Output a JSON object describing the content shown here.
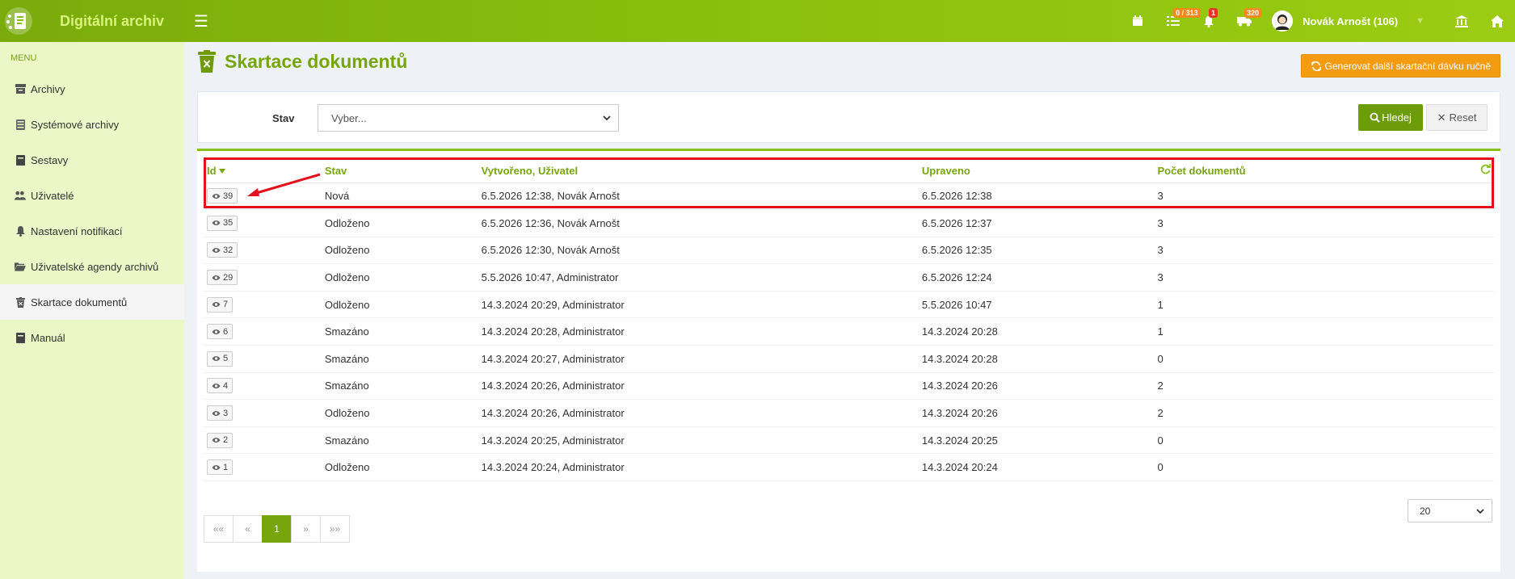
{
  "app": {
    "title": "Digitální archiv"
  },
  "topbar": {
    "tasks_badge": "0 / 313",
    "notif_badge": "1",
    "queue_badge": "320",
    "user_name": "Novák Arnošt (106)"
  },
  "sidebar": {
    "menu_label": "MENU",
    "items": [
      {
        "label": "Archivy",
        "icon": "archive-icon"
      },
      {
        "label": "Systémové archivy",
        "icon": "server-icon"
      },
      {
        "label": "Sestavy",
        "icon": "book-icon"
      },
      {
        "label": "Uživatelé",
        "icon": "users-icon"
      },
      {
        "label": "Nastavení notifikací",
        "icon": "bell-icon"
      },
      {
        "label": "Uživatelské agendy archivů",
        "icon": "folder-open-icon"
      },
      {
        "label": "Skartace dokumentů",
        "icon": "trash-icon",
        "active": true
      },
      {
        "label": "Manuál",
        "icon": "book-icon"
      }
    ]
  },
  "page": {
    "title": "Skartace dokumentů",
    "generate_button": "Generovat další skartační dávku ručně"
  },
  "filter": {
    "stav_label": "Stav",
    "stav_placeholder": "Vyber...",
    "search_button": "Hledej",
    "reset_button": "Reset"
  },
  "table": {
    "headers": {
      "id": "Id",
      "stav": "Stav",
      "vytvoreno": "Vytvořeno",
      "uzivatel": "Uživatel",
      "upraveno": "Upraveno",
      "pocet": "Počet dokumentů"
    },
    "rows": [
      {
        "id": "39",
        "stav": "Nová",
        "vytvoreno": "6.5.2026 12:38, Novák Arnošt",
        "upraveno": "6.5.2026 12:38",
        "pocet": "3"
      },
      {
        "id": "35",
        "stav": "Odloženo",
        "vytvoreno": "6.5.2026 12:36, Novák Arnošt",
        "upraveno": "6.5.2026 12:37",
        "pocet": "3"
      },
      {
        "id": "32",
        "stav": "Odloženo",
        "vytvoreno": "6.5.2026 12:30, Novák Arnošt",
        "upraveno": "6.5.2026 12:35",
        "pocet": "3"
      },
      {
        "id": "29",
        "stav": "Odloženo",
        "vytvoreno": "5.5.2026 10:47, Administrator",
        "upraveno": "6.5.2026 12:24",
        "pocet": "3"
      },
      {
        "id": "7",
        "stav": "Odloženo",
        "vytvoreno": "14.3.2024 20:29, Administrator",
        "upraveno": "5.5.2026 10:47",
        "pocet": "1"
      },
      {
        "id": "6",
        "stav": "Smazáno",
        "vytvoreno": "14.3.2024 20:28, Administrator",
        "upraveno": "14.3.2024 20:28",
        "pocet": "1"
      },
      {
        "id": "5",
        "stav": "Smazáno",
        "vytvoreno": "14.3.2024 20:27, Administrator",
        "upraveno": "14.3.2024 20:28",
        "pocet": "0"
      },
      {
        "id": "4",
        "stav": "Smazáno",
        "vytvoreno": "14.3.2024 20:26, Administrator",
        "upraveno": "14.3.2024 20:26",
        "pocet": "2"
      },
      {
        "id": "3",
        "stav": "Odloženo",
        "vytvoreno": "14.3.2024 20:26, Administrator",
        "upraveno": "14.3.2024 20:26",
        "pocet": "2"
      },
      {
        "id": "2",
        "stav": "Smazáno",
        "vytvoreno": "14.3.2024 20:25, Administrator",
        "upraveno": "14.3.2024 20:25",
        "pocet": "0"
      },
      {
        "id": "1",
        "stav": "Odloženo",
        "vytvoreno": "14.3.2024 20:24, Administrator",
        "upraveno": "14.3.2024 20:24",
        "pocet": "0"
      }
    ]
  },
  "pagination": {
    "first": "««",
    "prev": "«",
    "current": "1",
    "next": "»",
    "last": "»»",
    "page_size": "20"
  },
  "colors": {
    "brand": "#86bd0d",
    "title_green": "#77a60c",
    "sidebar_bg": "#ecf7c8",
    "orange": "#f39c12",
    "highlight_red": "#e3101d"
  }
}
